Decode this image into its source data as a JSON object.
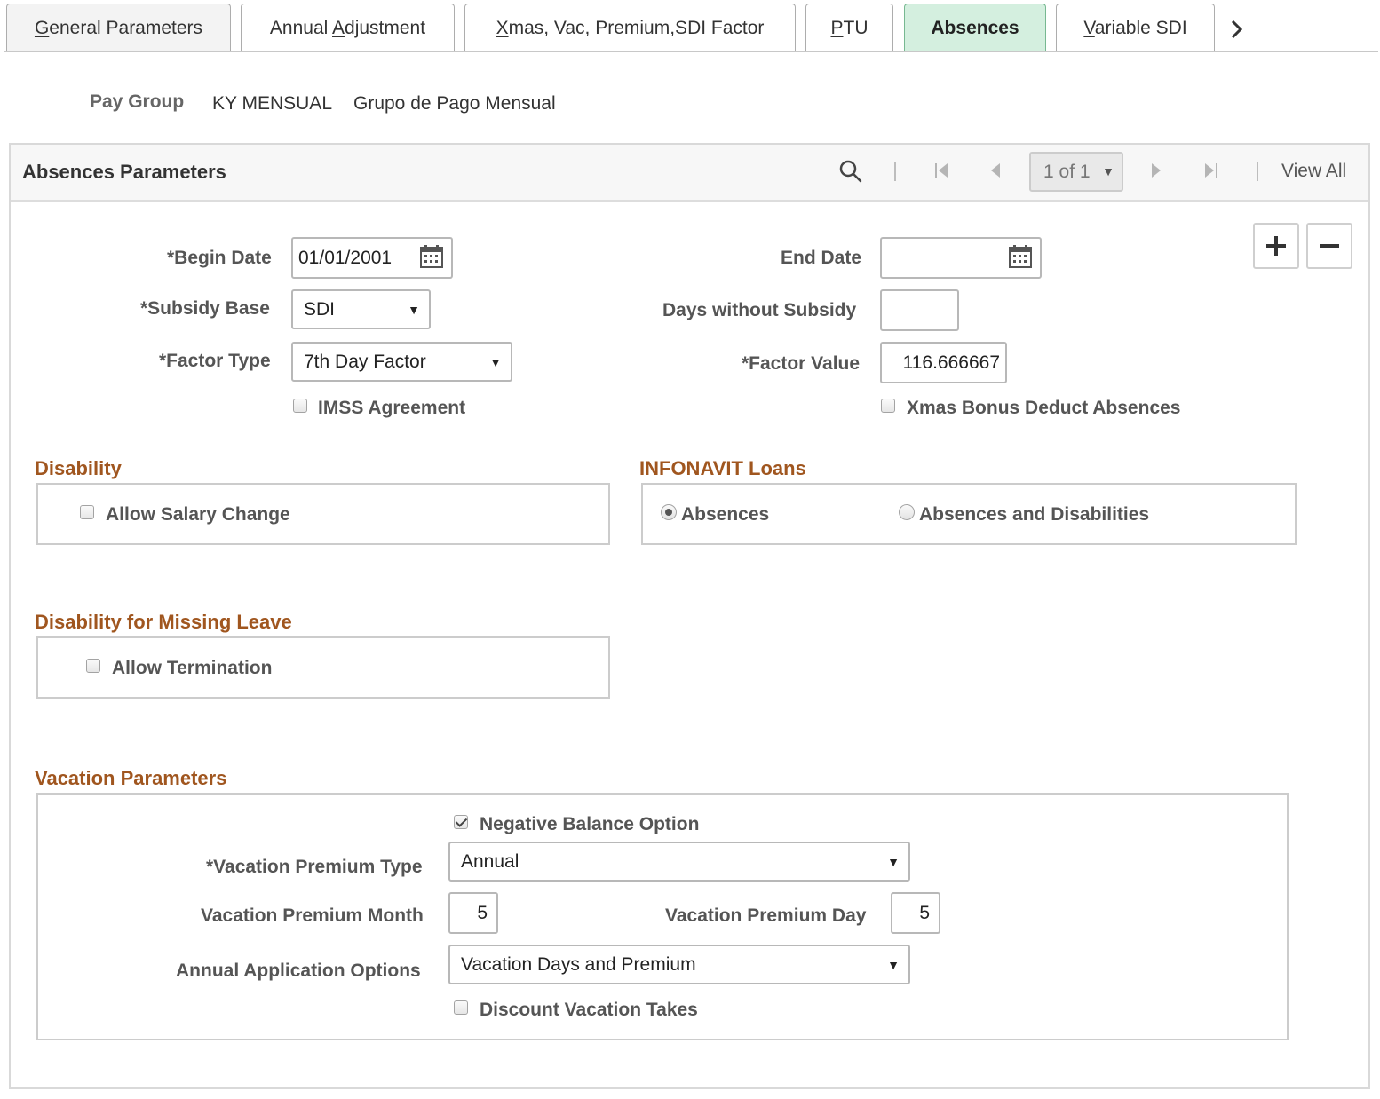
{
  "tabs": [
    {
      "label_pre": "",
      "label_key": "G",
      "label_post": "eneral Parameters",
      "active": false
    },
    {
      "label_pre": "Annual ",
      "label_key": "A",
      "label_post": "djustment",
      "active": false
    },
    {
      "label_pre": "",
      "label_key": "X",
      "label_post": "mas, Vac, Premium,SDI Factor",
      "active": false
    },
    {
      "label_pre": "",
      "label_key": "P",
      "label_post": "TU",
      "active": false
    },
    {
      "label_pre": "",
      "label_key": "",
      "label_post": "Absences",
      "active": true
    },
    {
      "label_pre": "",
      "label_key": "V",
      "label_post": "ariable SDI",
      "active": false
    }
  ],
  "header": {
    "pay_group_label": "Pay Group",
    "pay_group_code": "KY MENSUAL",
    "pay_group_desc": "Grupo de Pago Mensual"
  },
  "panel": {
    "title": "Absences Parameters",
    "pager": "1 of 1",
    "view_all": "View All"
  },
  "form": {
    "begin_date_label": "*Begin Date",
    "begin_date_value": "01/01/2001",
    "end_date_label": "End Date",
    "end_date_value": "",
    "subsidy_base_label": "*Subsidy Base",
    "subsidy_base_value": "SDI",
    "days_without_subsidy_label": "Days without Subsidy",
    "days_without_subsidy_value": "",
    "factor_type_label": "*Factor Type",
    "factor_type_value": "7th Day Factor",
    "factor_value_label": "*Factor Value",
    "factor_value_value": "116.666667",
    "imss_agreement_label": "IMSS Agreement",
    "imss_agreement_checked": false,
    "xmas_bonus_label": "Xmas Bonus Deduct Absences",
    "xmas_bonus_checked": false
  },
  "disability": {
    "title": "Disability",
    "allow_salary_change_label": "Allow Salary Change",
    "allow_salary_change_checked": false
  },
  "infonavit": {
    "title": "INFONAVIT Loans",
    "option_absences": "Absences",
    "option_absences_disabilities": "Absences and Disabilities",
    "selected": "Absences"
  },
  "missing_leave": {
    "title": "Disability for Missing Leave",
    "allow_termination_label": "Allow Termination",
    "allow_termination_checked": false
  },
  "vacation": {
    "title": "Vacation Parameters",
    "negative_balance_label": "Negative Balance Option",
    "negative_balance_checked": true,
    "premium_type_label": "*Vacation Premium Type",
    "premium_type_value": "Annual",
    "premium_month_label": "Vacation Premium Month",
    "premium_month_value": "5",
    "premium_day_label": "Vacation Premium Day",
    "premium_day_value": "5",
    "annual_options_label": "Annual Application Options",
    "annual_options_value": "Vacation Days and Premium",
    "discount_label": "Discount Vacation Takes",
    "discount_checked": false
  }
}
